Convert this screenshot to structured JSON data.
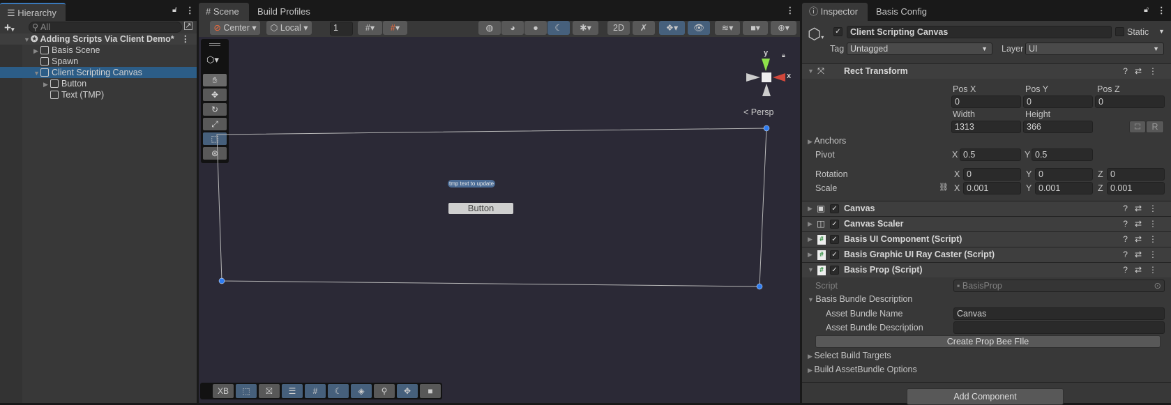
{
  "hierarchy": {
    "tab": "Hierarchy",
    "search_placeholder": "All",
    "scene_name": "Adding Scripts Via Client Demo*",
    "items": [
      {
        "label": "Basis Scene",
        "expandable": true
      },
      {
        "label": "Spawn",
        "expandable": false
      },
      {
        "label": "Client Scripting Canvas",
        "expandable": true,
        "selected": true
      },
      {
        "label": "Button",
        "expandable": true
      },
      {
        "label": "Text (TMP)",
        "expandable": false
      }
    ]
  },
  "scene": {
    "tabs": [
      "Scene",
      "Build Profiles"
    ],
    "pivot_mode": "Center",
    "pivot_rotation": "Local",
    "grid_size": "1",
    "persp_label": "Persp",
    "gizmo_axes": {
      "y": "y",
      "x": "x"
    },
    "tmp_text": "tmp text to update",
    "button_text": "Button",
    "overlay_first": "XB",
    "colors": {
      "background": "#2b2936",
      "selection": "#2c5d87",
      "active_button": "#46607c",
      "handle": "#2f7cf0"
    }
  },
  "inspector": {
    "tabs": [
      "Inspector",
      "Basis Config"
    ],
    "object_name": "Client Scripting Canvas",
    "static_label": "Static",
    "tag_label": "Tag",
    "tag_value": "Untagged",
    "layer_label": "Layer",
    "layer_value": "UI",
    "rect_transform": {
      "title": "Rect Transform",
      "pos_labels": [
        "Pos X",
        "Pos Y",
        "Pos Z"
      ],
      "pos_values": [
        "0",
        "0",
        "0"
      ],
      "width_label": "Width",
      "height_label": "Height",
      "width": "1313",
      "height": "366",
      "r_button": "R",
      "anchors_label": "Anchors",
      "pivot_label": "Pivot",
      "pivot": {
        "x": "0.5",
        "y": "0.5"
      },
      "rotation_label": "Rotation",
      "rotation": {
        "x": "0",
        "y": "0",
        "z": "0"
      },
      "scale_label": "Scale",
      "scale": {
        "x": "0.001",
        "y": "0.001",
        "z": "0.001"
      },
      "axis": {
        "x": "X",
        "y": "Y",
        "z": "Z"
      }
    },
    "components": [
      {
        "name": "Canvas"
      },
      {
        "name": "Canvas Scaler"
      },
      {
        "name": "Basis UI Component (Script)"
      },
      {
        "name": "Basis Graphic UI Ray Caster (Script)"
      },
      {
        "name": "Basis Prop (Script)"
      }
    ],
    "basis_prop": {
      "script_label": "Script",
      "script_value": "BasisProp",
      "bundle_desc_label": "Basis Bundle Description",
      "asset_name_label": "Asset Bundle Name",
      "asset_name_value": "Canvas",
      "asset_desc_label": "Asset Bundle Description",
      "asset_desc_value": "",
      "create_button": "Create Prop Bee FIle",
      "select_targets": "Select Build Targets",
      "build_options": "Build AssetBundle Options"
    },
    "add_component": "Add Component"
  }
}
